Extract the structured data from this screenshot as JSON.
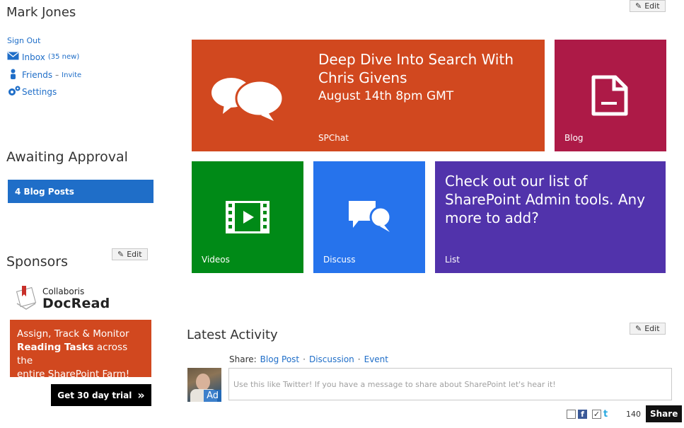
{
  "user": {
    "name": "Mark Jones"
  },
  "nav": {
    "sign_out": "Sign Out",
    "inbox": {
      "label": "Inbox",
      "count": "(35 new)"
    },
    "friends": {
      "label": "Friends",
      "separator": "–",
      "invite": "Invite"
    },
    "settings": {
      "label": "Settings"
    }
  },
  "approval": {
    "title": "Awaiting Approval",
    "button": "4 Blog Posts"
  },
  "edit_label": "Edit",
  "sponsors": {
    "title": "Sponsors",
    "logo_small": "Collaboris",
    "logo_large": "DocRead",
    "ad_line1": "Assign, Track & Monitor",
    "ad_bold": "Reading Tasks",
    "ad_line2": " across the",
    "ad_line3": "entire SharePoint Farm!",
    "trial_button": "Get 30 day trial",
    "trial_icon": "»"
  },
  "tiles": {
    "spchat": {
      "headline": "Deep Dive Into Search With Chris Givens",
      "subline": "August 14th 8pm GMT",
      "label": "SPChat",
      "color": "#d1481f",
      "icon": "chat-bubbles-icon"
    },
    "blog": {
      "label": "Blog",
      "color": "#ad1a47",
      "icon": "document-icon"
    },
    "videos": {
      "label": "Videos",
      "color": "#008a17",
      "icon": "film-icon"
    },
    "discuss": {
      "label": "Discuss",
      "color": "#2673ec",
      "icon": "discussion-icon"
    },
    "list": {
      "headline": "Check out our list of SharePoint Admin tools. Any more to add?",
      "label": "List",
      "color": "#5133ab"
    }
  },
  "activity": {
    "title": "Latest Activity",
    "share_prefix": "Share:",
    "share_links": [
      "Blog Post",
      "Discussion",
      "Event"
    ],
    "placeholder": "Use this like Twitter! If you have a message to share about SharePoint let's hear it!",
    "avatar_badge": "Ad",
    "char_count": "140",
    "share_button": "Share",
    "facebook_letter": "f",
    "twitter_letter": "t",
    "checkmark": "✓"
  }
}
